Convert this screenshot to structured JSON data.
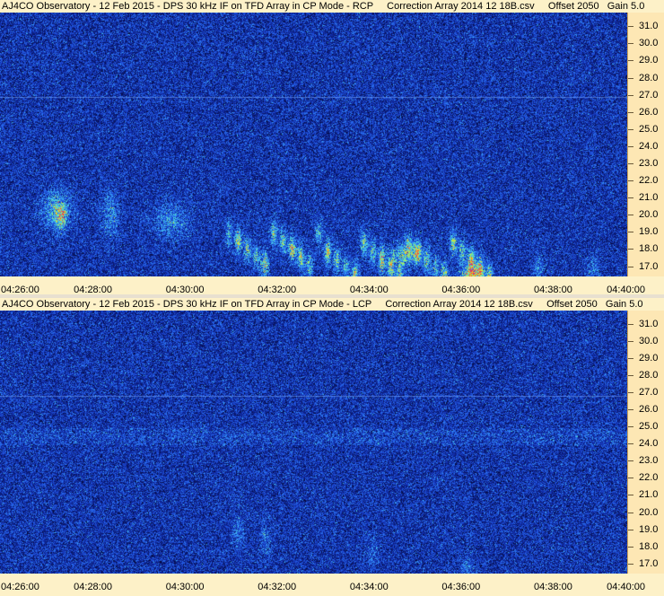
{
  "panels": [
    {
      "title": "AJ4CO Observatory - 12 Feb 2015 - DPS 30 kHz IF on TFD Array in CP Mode - RCP     Correction Array 2014 12 18B.csv     Offset 2050   Gain 5.0",
      "mode": "RCP"
    },
    {
      "title": "AJ4CO Observatory - 12 Feb 2015 - DPS 30 kHz IF on TFD Array in CP Mode - LCP     Correction Array 2014 12 18B.csv     Offset 2050   Gain 5.0",
      "mode": "LCP"
    }
  ],
  "frequency_axis": {
    "labels": [
      "31.0",
      "30.0",
      "29.0",
      "28.0",
      "27.0",
      "26.0",
      "25.0",
      "24.0",
      "23.0",
      "22.0",
      "21.0",
      "20.0",
      "19.0",
      "18.0",
      "17.0"
    ],
    "values": [
      31,
      30,
      29,
      28,
      27,
      26,
      25,
      24,
      23,
      22,
      21,
      20,
      19,
      18,
      17
    ],
    "range": [
      16.4,
      31.8
    ]
  },
  "time_axis": {
    "labels": [
      "04:26:00",
      "04:28:00",
      "04:30:00",
      "04:32:00",
      "04:34:00",
      "04:36:00",
      "04:38:00",
      "04:40:00"
    ]
  },
  "colors": {
    "background_blue": "#0d2a9a",
    "axis_panel": "#fde7b4",
    "time_strip": "#fdf1c8"
  }
}
